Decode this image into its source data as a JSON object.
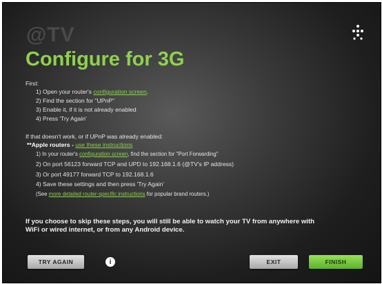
{
  "app": {
    "logo_text": "@TV",
    "title": "Configure for 3G"
  },
  "steps_first": {
    "label": "First:",
    "step1_pre": "1) Open your router's ",
    "step1_link": "configuration screen",
    "step1_post": ".",
    "step2": "2) Find the section for \"UPnP\"",
    "step3": "3) Enable it, if it is not already enabled",
    "step4": "4) Press 'Try Again'"
  },
  "steps_second": {
    "intro": "If that doesn't work, or if UPnP was already enabled:",
    "apple_label": "**Apple routers - ",
    "apple_link": "use these instructions",
    "s1_pre": "1) In your router's ",
    "s1_link": "configuration screen",
    "s1_post": ", find the section for \"Port Forwarding\"",
    "s2": "2) On port 56123 forward TCP and UPD to 192.168.1.6 (@TV's IP address)",
    "s3": "3) Or port 49177 forward TCP to 192.168.1.6",
    "s4": "4) Save these settings and then press 'Try Again'",
    "see_pre": "(See ",
    "see_link": "more detailed router-specific instructions",
    "see_post": " for popular brand routers.)"
  },
  "bottom_note": "If you choose to skip these steps, you will still be able to watch your TV from anywhere with WiFi or wired internet, or from any Android device.",
  "buttons": {
    "try_again": "TRY AGAIN",
    "info": "i",
    "exit": "EXIT",
    "finish": "FINISH"
  },
  "icons": {
    "menu": "dots-menu-icon",
    "info": "info-icon"
  },
  "colors": {
    "accent": "#8fd14f",
    "background": "#2a2a2a"
  }
}
